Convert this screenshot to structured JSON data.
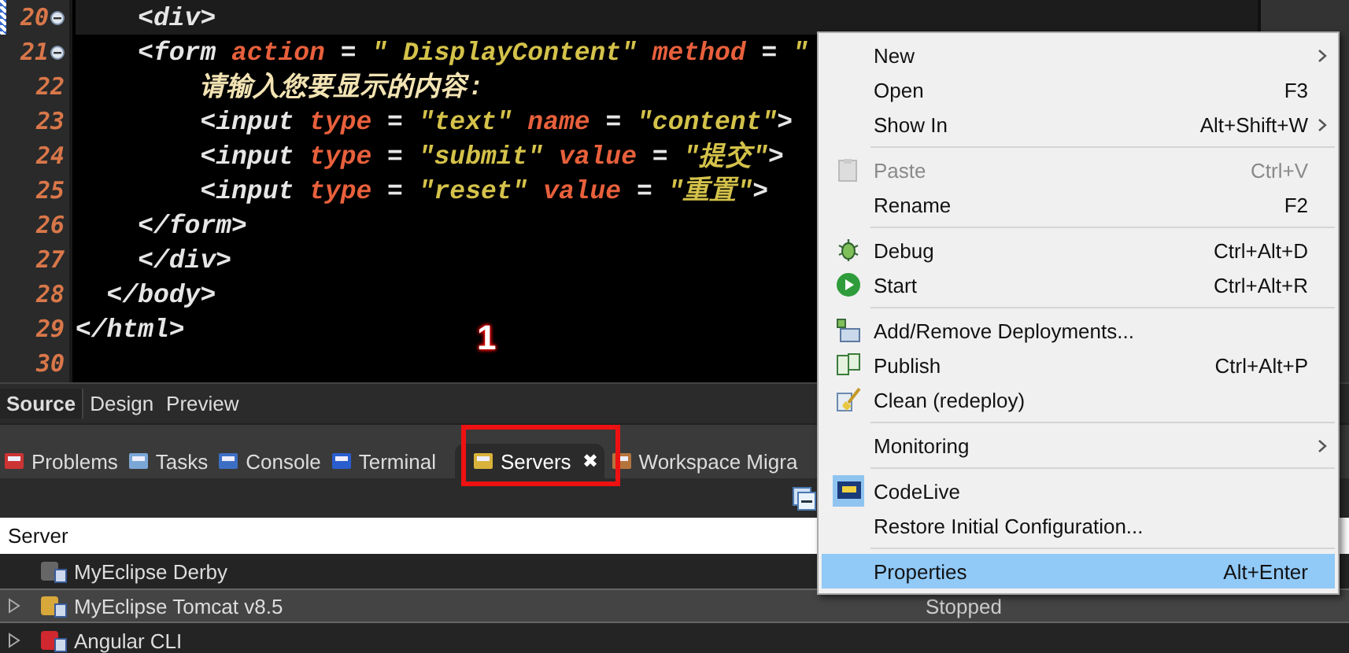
{
  "editor": {
    "lines": [
      {
        "number": "20",
        "fold": true,
        "current": true,
        "tokens": [
          {
            "kind": "tag",
            "text": "    <div>"
          }
        ]
      },
      {
        "number": "21",
        "fold": true,
        "current": false,
        "tokens": [
          {
            "kind": "tag",
            "text": "    <form"
          },
          {
            "kind": "attr",
            "text": " action"
          },
          {
            "kind": "punct",
            "text": " = "
          },
          {
            "kind": "value",
            "text": "\" DisplayContent\""
          },
          {
            "kind": "attr",
            "text": " method"
          },
          {
            "kind": "punct",
            "text": " = "
          },
          {
            "kind": "value",
            "text": "\""
          }
        ]
      },
      {
        "number": "22",
        "fold": false,
        "current": false,
        "tokens": [
          {
            "kind": "text",
            "text": "        请输入您要显示的内容:"
          }
        ]
      },
      {
        "number": "23",
        "fold": false,
        "current": false,
        "tokens": [
          {
            "kind": "tag",
            "text": "        <input"
          },
          {
            "kind": "attr",
            "text": " type"
          },
          {
            "kind": "punct",
            "text": " = "
          },
          {
            "kind": "value",
            "text": "\"text\""
          },
          {
            "kind": "attr",
            "text": " name"
          },
          {
            "kind": "punct",
            "text": " = "
          },
          {
            "kind": "value",
            "text": "\"content\""
          },
          {
            "kind": "tag",
            "text": ">"
          }
        ]
      },
      {
        "number": "24",
        "fold": false,
        "current": false,
        "tokens": [
          {
            "kind": "tag",
            "text": "        <input"
          },
          {
            "kind": "attr",
            "text": " type"
          },
          {
            "kind": "punct",
            "text": " = "
          },
          {
            "kind": "value",
            "text": "\"submit\""
          },
          {
            "kind": "attr",
            "text": " value"
          },
          {
            "kind": "punct",
            "text": " = "
          },
          {
            "kind": "value",
            "text": "\"提交\""
          },
          {
            "kind": "tag",
            "text": ">"
          }
        ]
      },
      {
        "number": "25",
        "fold": false,
        "current": false,
        "tokens": [
          {
            "kind": "tag",
            "text": "        <input"
          },
          {
            "kind": "attr",
            "text": " type"
          },
          {
            "kind": "punct",
            "text": " = "
          },
          {
            "kind": "value",
            "text": "\"reset\""
          },
          {
            "kind": "attr",
            "text": " value"
          },
          {
            "kind": "punct",
            "text": " = "
          },
          {
            "kind": "value",
            "text": "\"重置\""
          },
          {
            "kind": "tag",
            "text": ">"
          }
        ]
      },
      {
        "number": "26",
        "fold": false,
        "current": false,
        "tokens": [
          {
            "kind": "tag",
            "text": "    </form>"
          }
        ]
      },
      {
        "number": "27",
        "fold": false,
        "current": false,
        "tokens": [
          {
            "kind": "tag",
            "text": "    </div>"
          }
        ]
      },
      {
        "number": "28",
        "fold": false,
        "current": false,
        "tokens": [
          {
            "kind": "tag",
            "text": "  </body>"
          }
        ]
      },
      {
        "number": "29",
        "fold": false,
        "current": false,
        "tokens": [
          {
            "kind": "tag",
            "text": "</html>"
          }
        ]
      },
      {
        "number": "30",
        "fold": false,
        "current": false
      }
    ]
  },
  "editor_tabs": [
    {
      "label": "Source",
      "selected": true
    },
    {
      "label": "Design",
      "selected": false
    },
    {
      "label": "Preview",
      "selected": false
    }
  ],
  "annotation": {
    "label": "1"
  },
  "view_tabs": [
    {
      "label": "Problems",
      "selected": false,
      "closable": false
    },
    {
      "label": "Tasks",
      "selected": false,
      "closable": false
    },
    {
      "label": "Console",
      "selected": false,
      "closable": false
    },
    {
      "label": "Terminal",
      "selected": false,
      "closable": false
    },
    {
      "label": "Servers",
      "selected": true,
      "closable": true
    },
    {
      "label": "Workspace Migra",
      "selected": false,
      "closable": false
    }
  ],
  "close_glyph": "✖",
  "servers": {
    "column": "Server",
    "rows": [
      {
        "name": "MyEclipse Derby",
        "expandable": false,
        "selected": false
      },
      {
        "name": "MyEclipse Tomcat v8.5",
        "expandable": true,
        "selected": true,
        "status": "Stopped"
      },
      {
        "name": "Angular CLI",
        "expandable": true,
        "selected": false
      }
    ]
  },
  "context_menu": {
    "items": [
      {
        "kind": "item",
        "label": "New",
        "submenu": true,
        "disabled": false,
        "selected": false
      },
      {
        "kind": "item",
        "label": "Open",
        "shortcut": "F3",
        "submenu": false,
        "disabled": false,
        "selected": false
      },
      {
        "kind": "item",
        "label": "Show In",
        "shortcut": "Alt+Shift+W",
        "submenu": true,
        "disabled": false,
        "selected": false
      },
      {
        "kind": "separator"
      },
      {
        "kind": "item",
        "label": "Paste",
        "shortcut": "Ctrl+V",
        "submenu": false,
        "disabled": true,
        "selected": false
      },
      {
        "kind": "item",
        "label": "Rename",
        "shortcut": "F2",
        "submenu": false,
        "disabled": false,
        "selected": false
      },
      {
        "kind": "separator"
      },
      {
        "kind": "item",
        "label": "Debug",
        "shortcut": "Ctrl+Alt+D",
        "submenu": false,
        "disabled": false,
        "selected": false
      },
      {
        "kind": "item",
        "label": "Start",
        "shortcut": "Ctrl+Alt+R",
        "submenu": false,
        "disabled": false,
        "selected": false
      },
      {
        "kind": "separator"
      },
      {
        "kind": "item",
        "label": "Add/Remove Deployments...",
        "submenu": false,
        "disabled": false,
        "selected": false
      },
      {
        "kind": "item",
        "label": "Publish",
        "shortcut": "Ctrl+Alt+P",
        "submenu": false,
        "disabled": false,
        "selected": false
      },
      {
        "kind": "item",
        "label": "Clean (redeploy)",
        "submenu": false,
        "disabled": false,
        "selected": false
      },
      {
        "kind": "separator"
      },
      {
        "kind": "item",
        "label": "Monitoring",
        "submenu": true,
        "disabled": false,
        "selected": false
      },
      {
        "kind": "separator"
      },
      {
        "kind": "item",
        "label": "CodeLive",
        "submenu": false,
        "disabled": false,
        "selected": false
      },
      {
        "kind": "item",
        "label": "Restore Initial Configuration...",
        "submenu": false,
        "disabled": false,
        "selected": false
      },
      {
        "kind": "separator"
      },
      {
        "kind": "item",
        "label": "Properties",
        "shortcut": "Alt+Enter",
        "submenu": false,
        "disabled": false,
        "selected": true
      }
    ]
  }
}
